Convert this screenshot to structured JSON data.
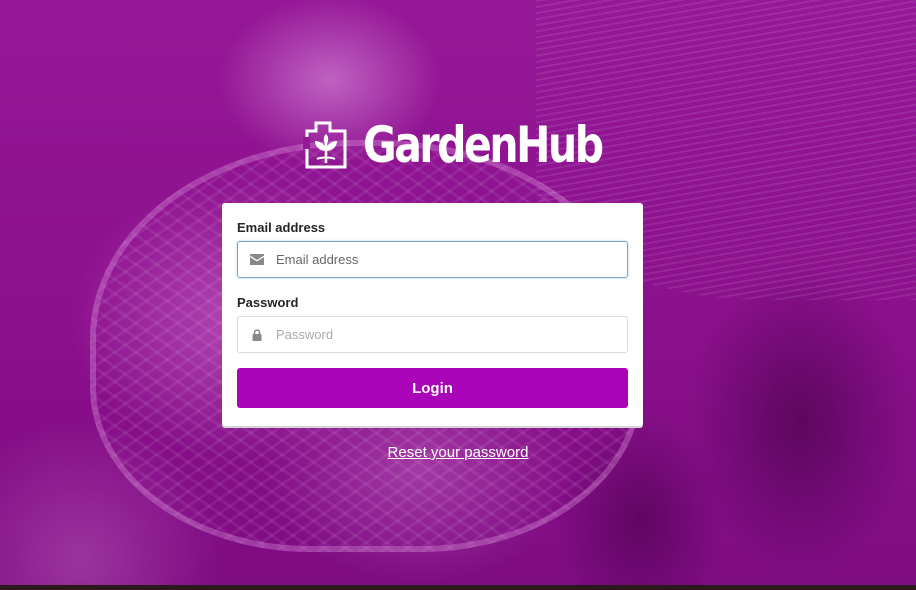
{
  "brand": {
    "name": "GardenHub",
    "logo_icon": "garden-house-icon"
  },
  "form": {
    "email": {
      "label": "Email address",
      "placeholder": "Email address",
      "value": "",
      "icon": "envelope-icon"
    },
    "password": {
      "label": "Password",
      "placeholder": "Password",
      "value": "",
      "icon": "lock-icon"
    },
    "submit_label": "Login"
  },
  "links": {
    "reset_password": "Reset your password"
  },
  "colors": {
    "background_tint": "#8e1291",
    "button": "#a904b8",
    "focus_border": "#7ba6c7"
  }
}
